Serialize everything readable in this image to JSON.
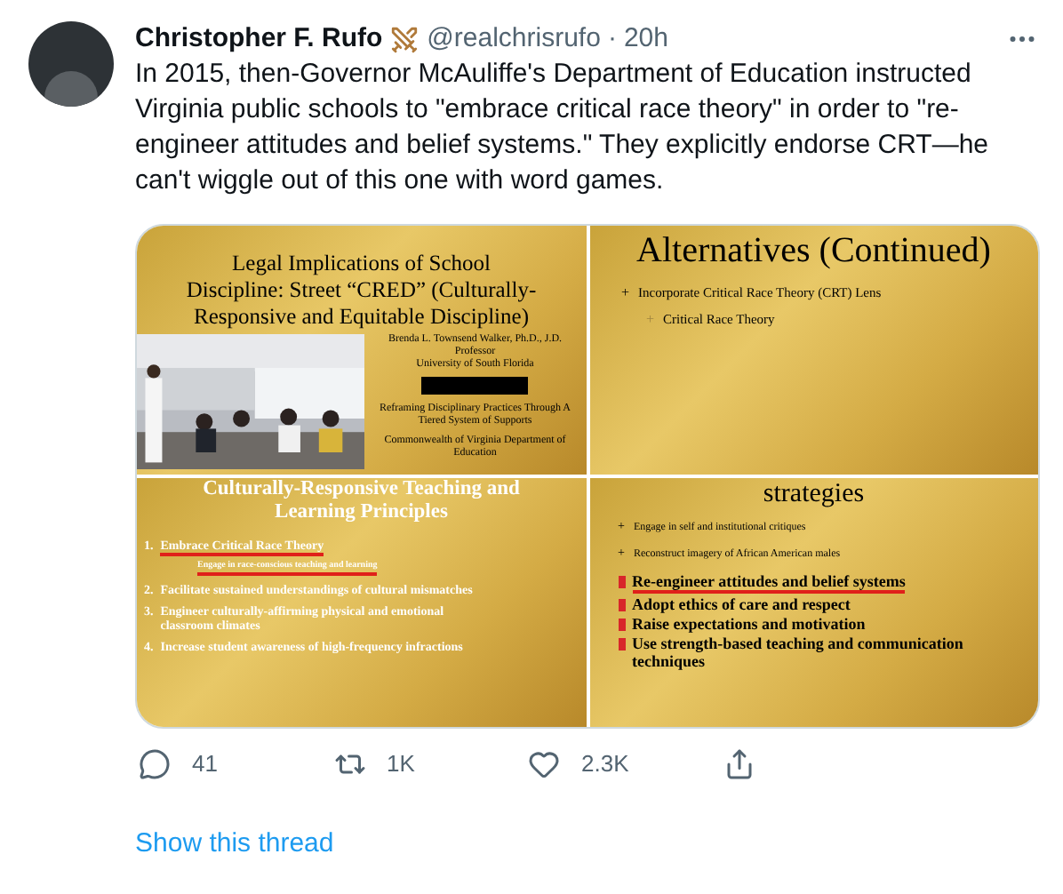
{
  "tweet": {
    "author": {
      "name": "Christopher F. Rufo",
      "handle": "@realchrisrufo",
      "separator": "·",
      "time": "20h"
    },
    "text": "In 2015, then-Governor McAuliffe's Department of Education instructed Virginia public schools to \"embrace critical race theory\" in order to \"re-engineer attitudes and belief systems.\" They explicitly endorse CRT—he can't wiggle out of this one with word games.",
    "slides": [
      {
        "kind": "cover",
        "title": [
          "Legal Implications of School",
          "Discipline:  Street “CRED” (Culturally-",
          "Responsive and Equitable Discipline)"
        ],
        "photo": {
          "kind": "picture"
        },
        "presenter": [
          "Brenda L. Townsend Walker, Ph.D., J.D.",
          "Professor",
          "University of South Florida"
        ],
        "redacted": true,
        "subtitle": "Reframing Disciplinary Practices Through A Tiered System of Supports",
        "organization": "Commonwealth of Virginia Department of Education"
      },
      {
        "kind": "outline",
        "title": "Alternatives (Continued)",
        "items": [
          {
            "marker": "+",
            "text": "Incorporate Critical Race Theory (CRT) Lens",
            "children": [
              {
                "marker": "+",
                "text": "Critical Race Theory"
              }
            ]
          }
        ]
      },
      {
        "kind": "numbered",
        "title": [
          "Culturally-Responsive Teaching and",
          "Learning Principles"
        ],
        "items": [
          {
            "kind": "point",
            "number": "1.",
            "text": "Embrace Critical Race Theory",
            "underlined": true
          },
          {
            "kind": "note",
            "text": "Engage in race-conscious teaching and learning",
            "underlined": true
          },
          {
            "kind": "point",
            "number": "2.",
            "text": "Facilitate sustained understandings of cultural mismatches",
            "underlined": false
          },
          {
            "kind": "point",
            "number": "3.",
            "text": "Engineer culturally-affirming physical and emotional classroom climates",
            "underlined": false
          },
          {
            "kind": "point",
            "number": "4.",
            "text": "Increase student awareness of high-frequency infractions",
            "underlined": false
          }
        ]
      },
      {
        "kind": "strategies",
        "title": "strategies",
        "items": [
          {
            "kind": "plus",
            "marker": "+",
            "text": "Engage in self and institutional critiques",
            "underlined": false
          },
          {
            "kind": "plus",
            "marker": "+",
            "text": "Reconstruct imagery of African American males",
            "underlined": false
          },
          {
            "kind": "square",
            "text": "Re-engineer attitudes and belief systems",
            "underlined": true
          },
          {
            "kind": "square",
            "text": "Adopt ethics of care and respect",
            "underlined": false
          },
          {
            "kind": "square",
            "text": "Raise expectations and motivation",
            "underlined": false
          },
          {
            "kind": "square",
            "text": "Use strength-based teaching and communication techniques",
            "underlined": false
          }
        ]
      }
    ],
    "actions": [
      {
        "kind": "reply",
        "count": "41"
      },
      {
        "kind": "retweet",
        "count": "1K"
      },
      {
        "kind": "like",
        "count": "2.3K"
      },
      {
        "kind": "share"
      }
    ],
    "thread_link": "Show this thread"
  }
}
